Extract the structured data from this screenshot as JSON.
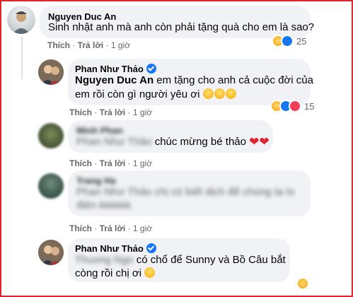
{
  "comments": [
    {
      "author": "Nguyen Duc An",
      "text": "Sinh nhật anh mà anh còn phải tặng quà cho em là sao?",
      "like": "Thích",
      "reply": "Trả lời",
      "time": "1 giờ",
      "reaction_count": "25"
    },
    {
      "author": "Phan Như Thảo",
      "tag": "Nguyen Duc An",
      "text_line1": " em tặng cho anh cả cuộc đời của",
      "text_line2": "em rồi còn gì người yêu ơi",
      "like": "Thích",
      "reply": "Trả lời",
      "time": "1 giờ",
      "reaction_count": "15"
    },
    {
      "author_blurred": "Minh Phan",
      "tag_blurred": "Phan Như Thảo",
      "text": "chúc mừng bé thảo",
      "like": "Thích",
      "reply": "Trả lời",
      "time": "1 giờ"
    },
    {
      "author_blurred": "Trang Ha",
      "text_blurred_line1": "Phan Như Thảo chị có biết dịch để chúng ta lo",
      "text_blurred_line2": "điên kkkkkk",
      "like": "Thích",
      "reply": "Trả lời",
      "time": "1 giờ"
    },
    {
      "author": "Phan Như Thảo",
      "tag_blurred": "Thuong Ngo",
      "text_line1": "có chổ để Sunny và Bồ Câu bắt",
      "text_line2": "còng rồi chị ơi"
    }
  ]
}
